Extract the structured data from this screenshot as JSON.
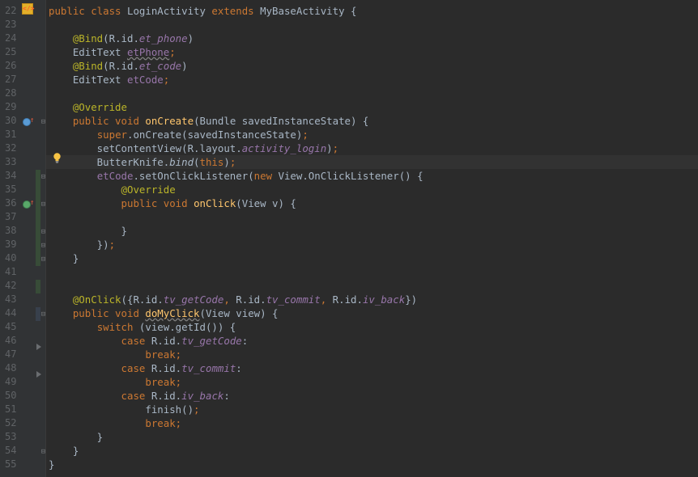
{
  "editor": {
    "lines": [
      {
        "n": "22",
        "tokens": [
          [
            "kw",
            "public class "
          ],
          [
            "",
            "LoginActivity "
          ],
          [
            "kw",
            "extends "
          ],
          [
            "",
            "MyBaseActivity {"
          ]
        ]
      },
      {
        "n": "23",
        "tokens": []
      },
      {
        "n": "24",
        "tokens": [
          [
            "",
            "    "
          ],
          [
            "ann",
            "@Bind"
          ],
          [
            "",
            "(R.id."
          ],
          [
            "fld it",
            "et_phone"
          ],
          [
            "",
            ")"
          ]
        ]
      },
      {
        "n": "25",
        "tokens": [
          [
            "",
            "    EditText "
          ],
          [
            "fld err",
            "etPhone"
          ],
          [
            "kw",
            ";"
          ]
        ]
      },
      {
        "n": "26",
        "tokens": [
          [
            "",
            "    "
          ],
          [
            "ann",
            "@Bind"
          ],
          [
            "",
            "(R.id."
          ],
          [
            "fld it",
            "et_code"
          ],
          [
            "",
            ")"
          ]
        ]
      },
      {
        "n": "27",
        "tokens": [
          [
            "",
            "    EditText "
          ],
          [
            "fld",
            "etCode"
          ],
          [
            "kw",
            ";"
          ]
        ]
      },
      {
        "n": "28",
        "tokens": []
      },
      {
        "n": "29",
        "tokens": [
          [
            "",
            "    "
          ],
          [
            "ann",
            "@Override"
          ]
        ]
      },
      {
        "n": "30",
        "tokens": [
          [
            "",
            "    "
          ],
          [
            "kw",
            "public void "
          ],
          [
            "fn",
            "onCreate"
          ],
          [
            "",
            "(Bundle savedInstanceState) {"
          ]
        ]
      },
      {
        "n": "31",
        "tokens": [
          [
            "",
            "        "
          ],
          [
            "kw",
            "super"
          ],
          [
            "",
            ".onCreate(savedInstanceState)"
          ],
          [
            "kw",
            ";"
          ]
        ]
      },
      {
        "n": "32",
        "tokens": [
          [
            "",
            "        setContentView(R.layout."
          ],
          [
            "fld it",
            "activity_login"
          ],
          [
            "",
            ")"
          ],
          [
            "kw",
            ";"
          ]
        ]
      },
      {
        "n": "33",
        "tokens": [
          [
            "",
            "        ButterKnife."
          ],
          [
            "it",
            "bind"
          ],
          [
            "",
            "("
          ],
          [
            "kw",
            "this"
          ],
          [
            "",
            ")"
          ],
          [
            "kw",
            ";"
          ]
        ]
      },
      {
        "n": "34",
        "tokens": [
          [
            "",
            "        "
          ],
          [
            "fld",
            "etCode"
          ],
          [
            "",
            ".setOnClickListener("
          ],
          [
            "kw",
            "new "
          ],
          [
            "",
            "View.OnClickListener() {"
          ]
        ]
      },
      {
        "n": "35",
        "tokens": [
          [
            "",
            "            "
          ],
          [
            "ann",
            "@Override"
          ]
        ]
      },
      {
        "n": "36",
        "tokens": [
          [
            "",
            "            "
          ],
          [
            "kw",
            "public void "
          ],
          [
            "fn",
            "onClick"
          ],
          [
            "",
            "(View v) {"
          ]
        ]
      },
      {
        "n": "37",
        "tokens": []
      },
      {
        "n": "38",
        "tokens": [
          [
            "",
            "            }"
          ]
        ]
      },
      {
        "n": "39",
        "tokens": [
          [
            "",
            "        })"
          ],
          [
            "kw",
            ";"
          ]
        ]
      },
      {
        "n": "40",
        "tokens": [
          [
            "",
            "    }"
          ]
        ]
      },
      {
        "n": "41",
        "tokens": []
      },
      {
        "n": "42",
        "tokens": []
      },
      {
        "n": "43",
        "tokens": [
          [
            "",
            "    "
          ],
          [
            "ann",
            "@OnClick"
          ],
          [
            "",
            "({R.id."
          ],
          [
            "fld it",
            "tv_getCode"
          ],
          [
            "kw",
            ", "
          ],
          [
            "",
            "R.id."
          ],
          [
            "fld it",
            "tv_commit"
          ],
          [
            "kw",
            ", "
          ],
          [
            "",
            "R.id."
          ],
          [
            "fld it",
            "iv_back"
          ],
          [
            "",
            "})"
          ]
        ]
      },
      {
        "n": "44",
        "tokens": [
          [
            "",
            "    "
          ],
          [
            "kw",
            "public void "
          ],
          [
            "fn err",
            "doMyClick"
          ],
          [
            "",
            "(View view) {"
          ]
        ]
      },
      {
        "n": "45",
        "tokens": [
          [
            "",
            "        "
          ],
          [
            "kw",
            "switch "
          ],
          [
            "",
            "(view.getId()) {"
          ]
        ]
      },
      {
        "n": "46",
        "tokens": [
          [
            "",
            "            "
          ],
          [
            "kw",
            "case "
          ],
          [
            "",
            "R.id."
          ],
          [
            "fld it",
            "tv_getCode"
          ],
          [
            "",
            ":"
          ]
        ]
      },
      {
        "n": "47",
        "tokens": [
          [
            "",
            "                "
          ],
          [
            "kw",
            "break;"
          ]
        ]
      },
      {
        "n": "48",
        "tokens": [
          [
            "",
            "            "
          ],
          [
            "kw",
            "case "
          ],
          [
            "",
            "R.id."
          ],
          [
            "fld it",
            "tv_commit"
          ],
          [
            "",
            ":"
          ]
        ]
      },
      {
        "n": "49",
        "tokens": [
          [
            "",
            "                "
          ],
          [
            "kw",
            "break;"
          ]
        ]
      },
      {
        "n": "50",
        "tokens": [
          [
            "",
            "            "
          ],
          [
            "kw",
            "case "
          ],
          [
            "",
            "R.id."
          ],
          [
            "fld it",
            "iv_back"
          ],
          [
            "",
            ":"
          ]
        ]
      },
      {
        "n": "51",
        "tokens": [
          [
            "",
            "                finish()"
          ],
          [
            "kw",
            ";"
          ]
        ]
      },
      {
        "n": "52",
        "tokens": [
          [
            "",
            "                "
          ],
          [
            "kw",
            "break;"
          ]
        ]
      },
      {
        "n": "53",
        "tokens": [
          [
            "",
            "        }"
          ]
        ]
      },
      {
        "n": "54",
        "tokens": [
          [
            "",
            "    }"
          ]
        ]
      },
      {
        "n": "55",
        "tokens": [
          [
            "",
            "}"
          ]
        ]
      }
    ],
    "current_line": "33",
    "icons": {
      "class_marker": "class-file-icon",
      "override_30": "override-method-icon",
      "override_36": "implement-method-icon",
      "intention": "lightbulb-icon"
    }
  }
}
